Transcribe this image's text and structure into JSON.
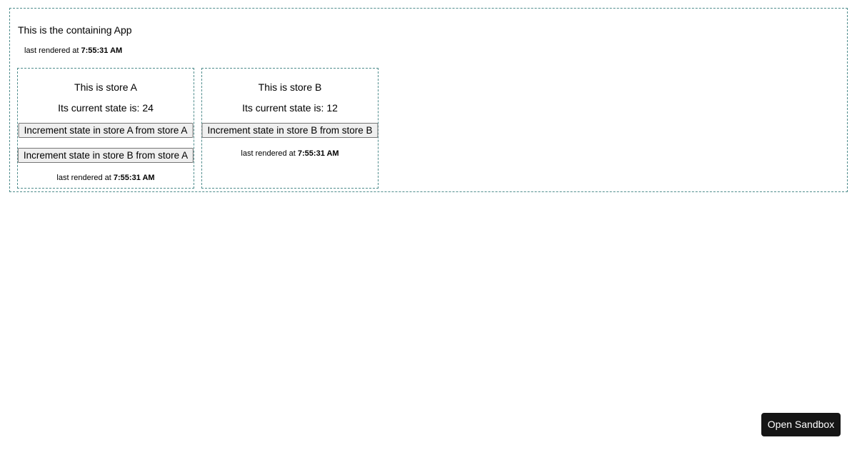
{
  "app": {
    "title": "This is the containing App",
    "rendered_prefix": "last rendered at",
    "rendered_time": "7:55:31 AM"
  },
  "store_a": {
    "title": "This is store A",
    "state_text": "Its current state is: 24",
    "buttons": [
      {
        "label": "Increment state in store A from store A"
      },
      {
        "label": "Increment state in store B from store A"
      }
    ],
    "rendered_prefix": "last rendered at",
    "rendered_time": "7:55:31 AM"
  },
  "store_b": {
    "title": "This is store B",
    "state_text": "Its current state is: 12",
    "buttons": [
      {
        "label": "Increment state in store B from store B"
      }
    ],
    "rendered_prefix": "last rendered at",
    "rendered_time": "7:55:31 AM"
  },
  "sandbox": {
    "label": "Open Sandbox"
  }
}
